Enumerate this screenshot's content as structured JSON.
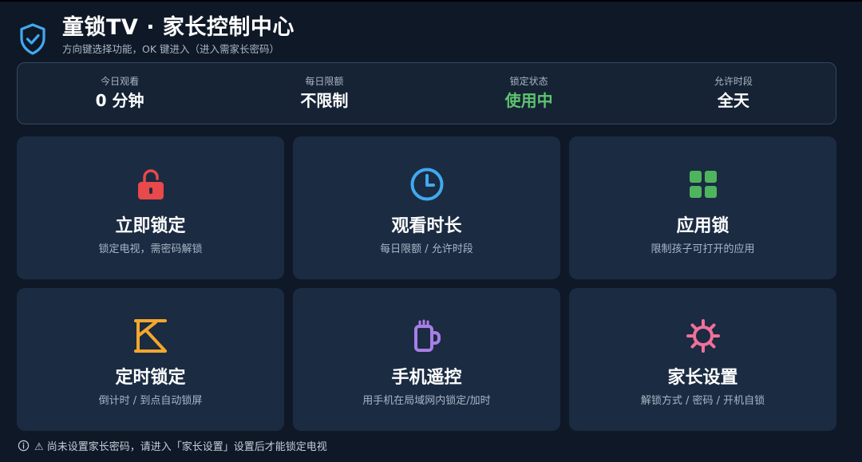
{
  "header": {
    "title": "童锁TV · 家长控制中心",
    "subtitle": "方向键选择功能，OK 键进入（进入需家长密码）",
    "logo_icon": "shield-check-icon"
  },
  "stats": [
    {
      "label": "今日观看",
      "value": "0 分钟",
      "color": "#ffffff"
    },
    {
      "label": "每日限额",
      "value": "不限制",
      "color": "#ffffff"
    },
    {
      "label": "锁定状态",
      "value": "使用中",
      "color": "#5ec46f"
    },
    {
      "label": "允许时段",
      "value": "全天",
      "color": "#ffffff"
    }
  ],
  "cards": [
    {
      "title": "立即锁定",
      "desc": "锁定电视，需密码解锁",
      "icon": "lock-icon",
      "color": "#e8494a"
    },
    {
      "title": "观看时长",
      "desc": "每日限额 / 允许时段",
      "icon": "clock-icon",
      "color": "#41a9ef"
    },
    {
      "title": "应用锁",
      "desc": "限制孩子可打开的应用",
      "icon": "apps-grid-icon",
      "color": "#4fb45e"
    },
    {
      "title": "定时锁定",
      "desc": "倒计时 / 到点自动锁屏",
      "icon": "timer-icon",
      "color": "#f3a72c"
    },
    {
      "title": "手机遥控",
      "desc": "用手机在局域网内锁定/加时",
      "icon": "phone-remote-icon",
      "color": "#a77ee6"
    },
    {
      "title": "家长设置",
      "desc": "解锁方式 / 密码 / 开机自锁",
      "icon": "gear-icon",
      "color": "#f0709a"
    }
  ],
  "footer": {
    "text": "⚠ 尚未设置家长密码，请进入「家长设置」设置后才能锁定电视",
    "icon": "info-icon"
  },
  "colors": {
    "background": "#0f1826",
    "card": "#1b2b42",
    "accent": "#41a9ef"
  }
}
